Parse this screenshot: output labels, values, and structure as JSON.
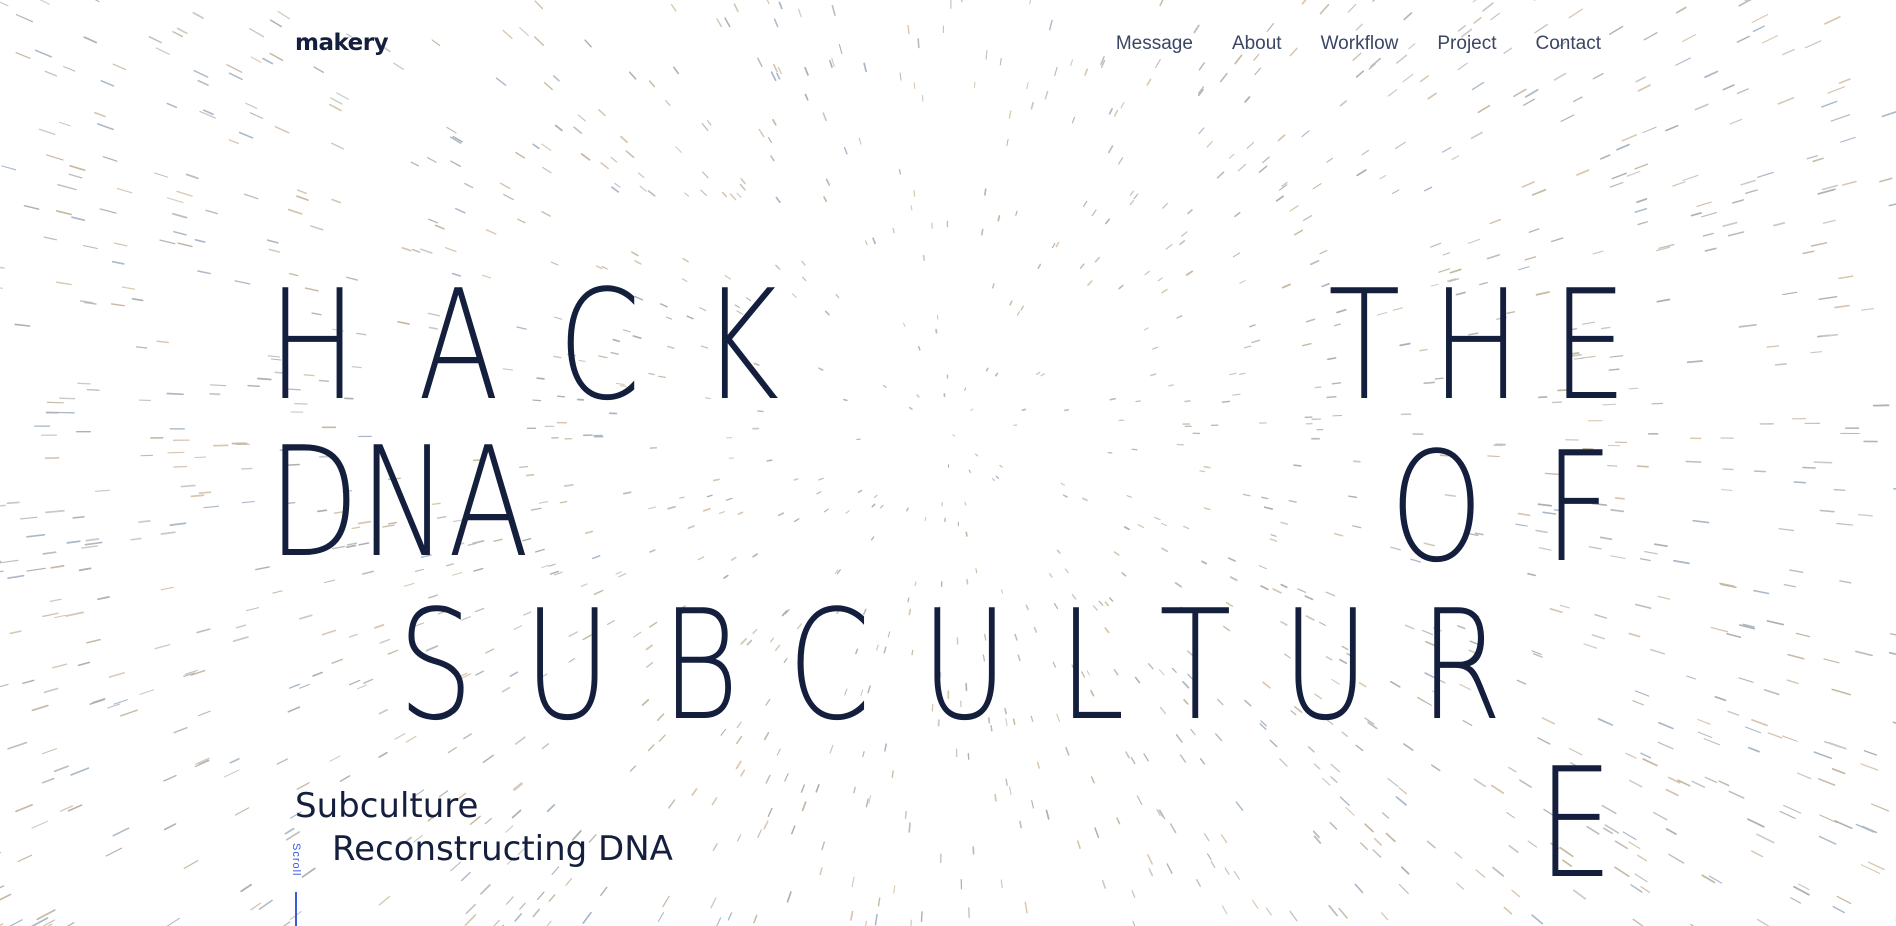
{
  "brand": {
    "logo": "makery"
  },
  "nav": {
    "items": [
      {
        "label": "Message"
      },
      {
        "label": "About"
      },
      {
        "label": "Workflow"
      },
      {
        "label": "Project"
      },
      {
        "label": "Contact"
      }
    ]
  },
  "hero": {
    "row1_left": "HACK",
    "row1_right": "THE",
    "row2_left": "DNA",
    "row2_right": "OF",
    "row3": "SUBCULTUR",
    "row4": "E"
  },
  "subtitle": {
    "line1": "Subculture",
    "line2": "Reconstructing DNA"
  },
  "scroll": {
    "label": "Scroll"
  },
  "colors": {
    "text": "#141e3d",
    "nav": "#3b4564",
    "accent": "#3d5bd9"
  }
}
